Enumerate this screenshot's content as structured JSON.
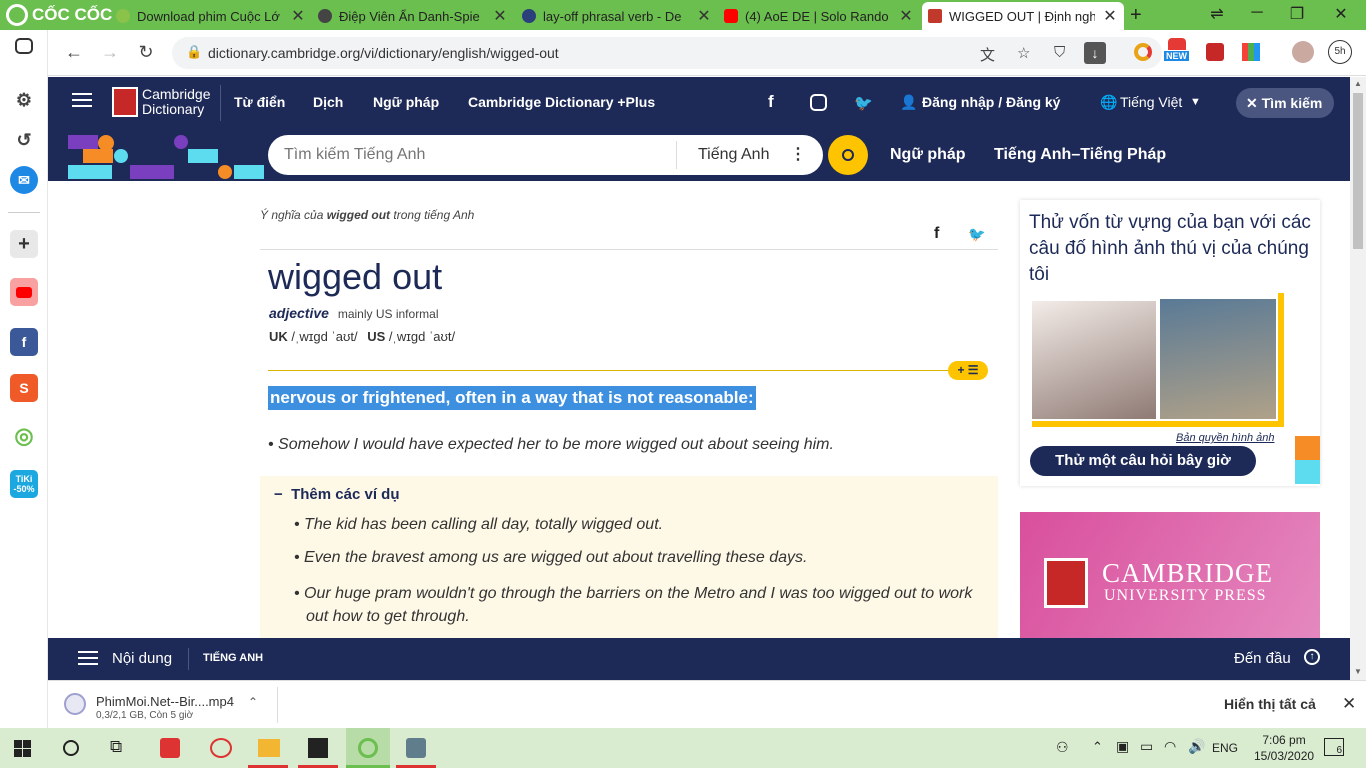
{
  "browser": {
    "brand": "CỐC CỐC",
    "tabs": [
      {
        "title": "Download phim Cuộc Lớ",
        "favicon_color": "#8bc34a"
      },
      {
        "title": "Điệp Viên Ẩn Danh-Spie",
        "favicon_color": "#444444"
      },
      {
        "title": "lay-off phrasal verb - De",
        "favicon_color": "#2b3f7a"
      },
      {
        "title": "(4) AoE DE | Solo Rando",
        "favicon_color": "#ff0000"
      },
      {
        "title": "WIGGED OUT | Định ngh",
        "favicon_color": "#c0392b"
      }
    ],
    "url": "dictionary.cambridge.org/vi/dictionary/english/wigged-out",
    "new_badge": "NEW",
    "profile_timer": "5h"
  },
  "site": {
    "logo_line1": "Cambridge",
    "logo_line2": "Dictionary",
    "nav": [
      "Từ điển",
      "Dịch",
      "Ngữ pháp",
      "Cambridge Dictionary +Plus"
    ],
    "login": "Đăng nhập / Đăng ký",
    "language": "Tiếng Việt",
    "search_toggle": "Tìm kiếm",
    "search_placeholder": "Tìm kiếm Tiếng Anh",
    "search_lang": "Tiếng Anh",
    "sub_nav": [
      "Ngữ pháp",
      "Tiếng Anh–Tiếng Pháp"
    ]
  },
  "entry": {
    "meaning_prefix": "Ý nghĩa của",
    "meaning_word": "wigged out",
    "meaning_suffix": "trong tiếng Anh",
    "headword": "wigged out",
    "pos": "adjective",
    "usage": "mainly US informal",
    "uk_label": "UK",
    "uk_ipa": "/ˌwɪɡd ˈaʊt/",
    "us_label": "US",
    "us_ipa": "/ˌwɪɡd ˈaʊt/",
    "definition": "nervous or frightened, often in a way that is not reasonable:",
    "example": "Somehow I would have expected her to be more wigged out about seeing him.",
    "more_examples_label": "Thêm các ví dụ",
    "more_examples": [
      "The kid has been calling all day, totally wigged out.",
      "Even the bravest among us are wigged out about travelling these days.",
      "Our huge pram wouldn't go through the barriers on the Metro and I was too wigged out to work out how to get through."
    ],
    "toggle_label": "+ ☰"
  },
  "sidebar_ad": {
    "quiz_title": "Thử vốn từ vựng của bạn với các câu đố hình ảnh thú vị của chúng tôi",
    "copyright": "Bản quyền hình ảnh",
    "quiz_button": "Thử một câu hỏi bây giờ",
    "press_line1": "CAMBRIDGE",
    "press_line2": "UNIVERSITY PRESS"
  },
  "bottom_bar": {
    "contents": "Nội dung",
    "section": "TIẾNG ANH",
    "to_top": "Đến đầu"
  },
  "download": {
    "filename": "PhimMoi.Net--Bir....mp4",
    "status": "0,3/2,1 GB, Còn 5 giờ",
    "show_all": "Hiển thị tất cả"
  },
  "taskbar": {
    "language": "ENG",
    "time": "7:06 pm",
    "date": "15/03/2020",
    "notifications": "6"
  },
  "sidebar_apps": {
    "tiki_label": "TiKi",
    "tiki_discount": "-50%"
  }
}
